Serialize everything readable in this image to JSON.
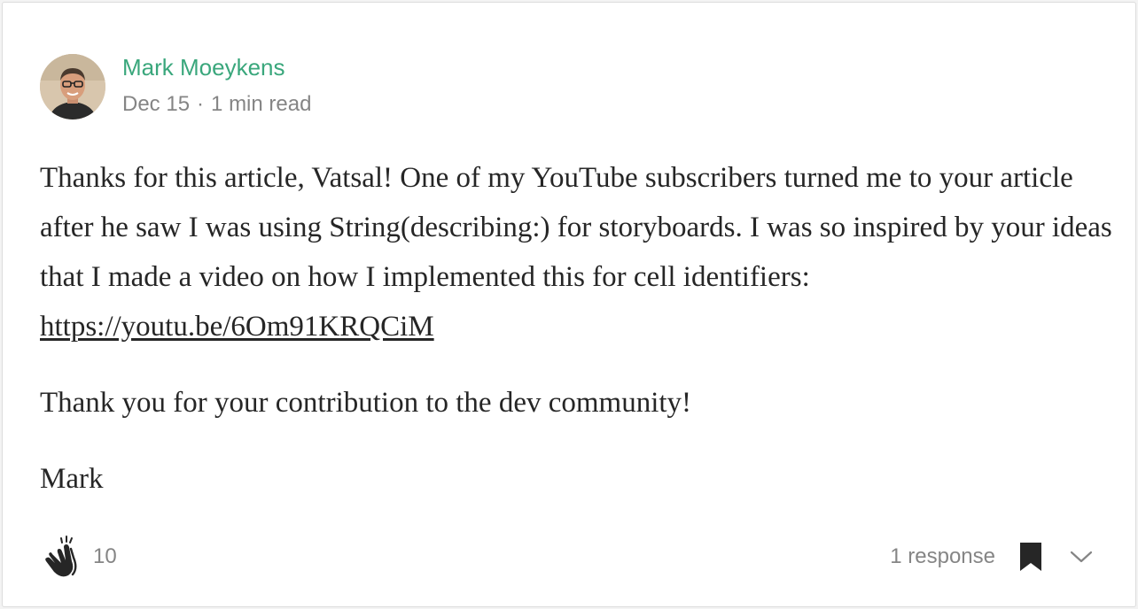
{
  "author": {
    "name": "Mark Moeykens",
    "avatar_icon": "author-avatar-photo"
  },
  "meta": {
    "date": "Dec 15",
    "separator": "·",
    "read_time": "1 min read"
  },
  "body": {
    "paragraph1_text": "Thanks for this article, Vatsal! One of my YouTube subscribers turned me to your article after he saw I was using String(describing:) for storyboards. I was so inspired by your ideas that I made a video on how I implemented this for cell identifiers: ",
    "paragraph1_link": "https://youtu.be/6Om91KRQCiM",
    "paragraph2": "Thank you for your contribution to the dev community!",
    "signature": "Mark"
  },
  "footer": {
    "clap_icon": "clap-hands-icon",
    "clap_count": "10",
    "responses": "1 response",
    "bookmark_icon": "bookmark-icon",
    "more_icon": "chevron-down-icon"
  },
  "colors": {
    "author_name": "#3aa77c",
    "meta_text": "#858585",
    "body_text": "#262626",
    "icon": "#262626"
  }
}
